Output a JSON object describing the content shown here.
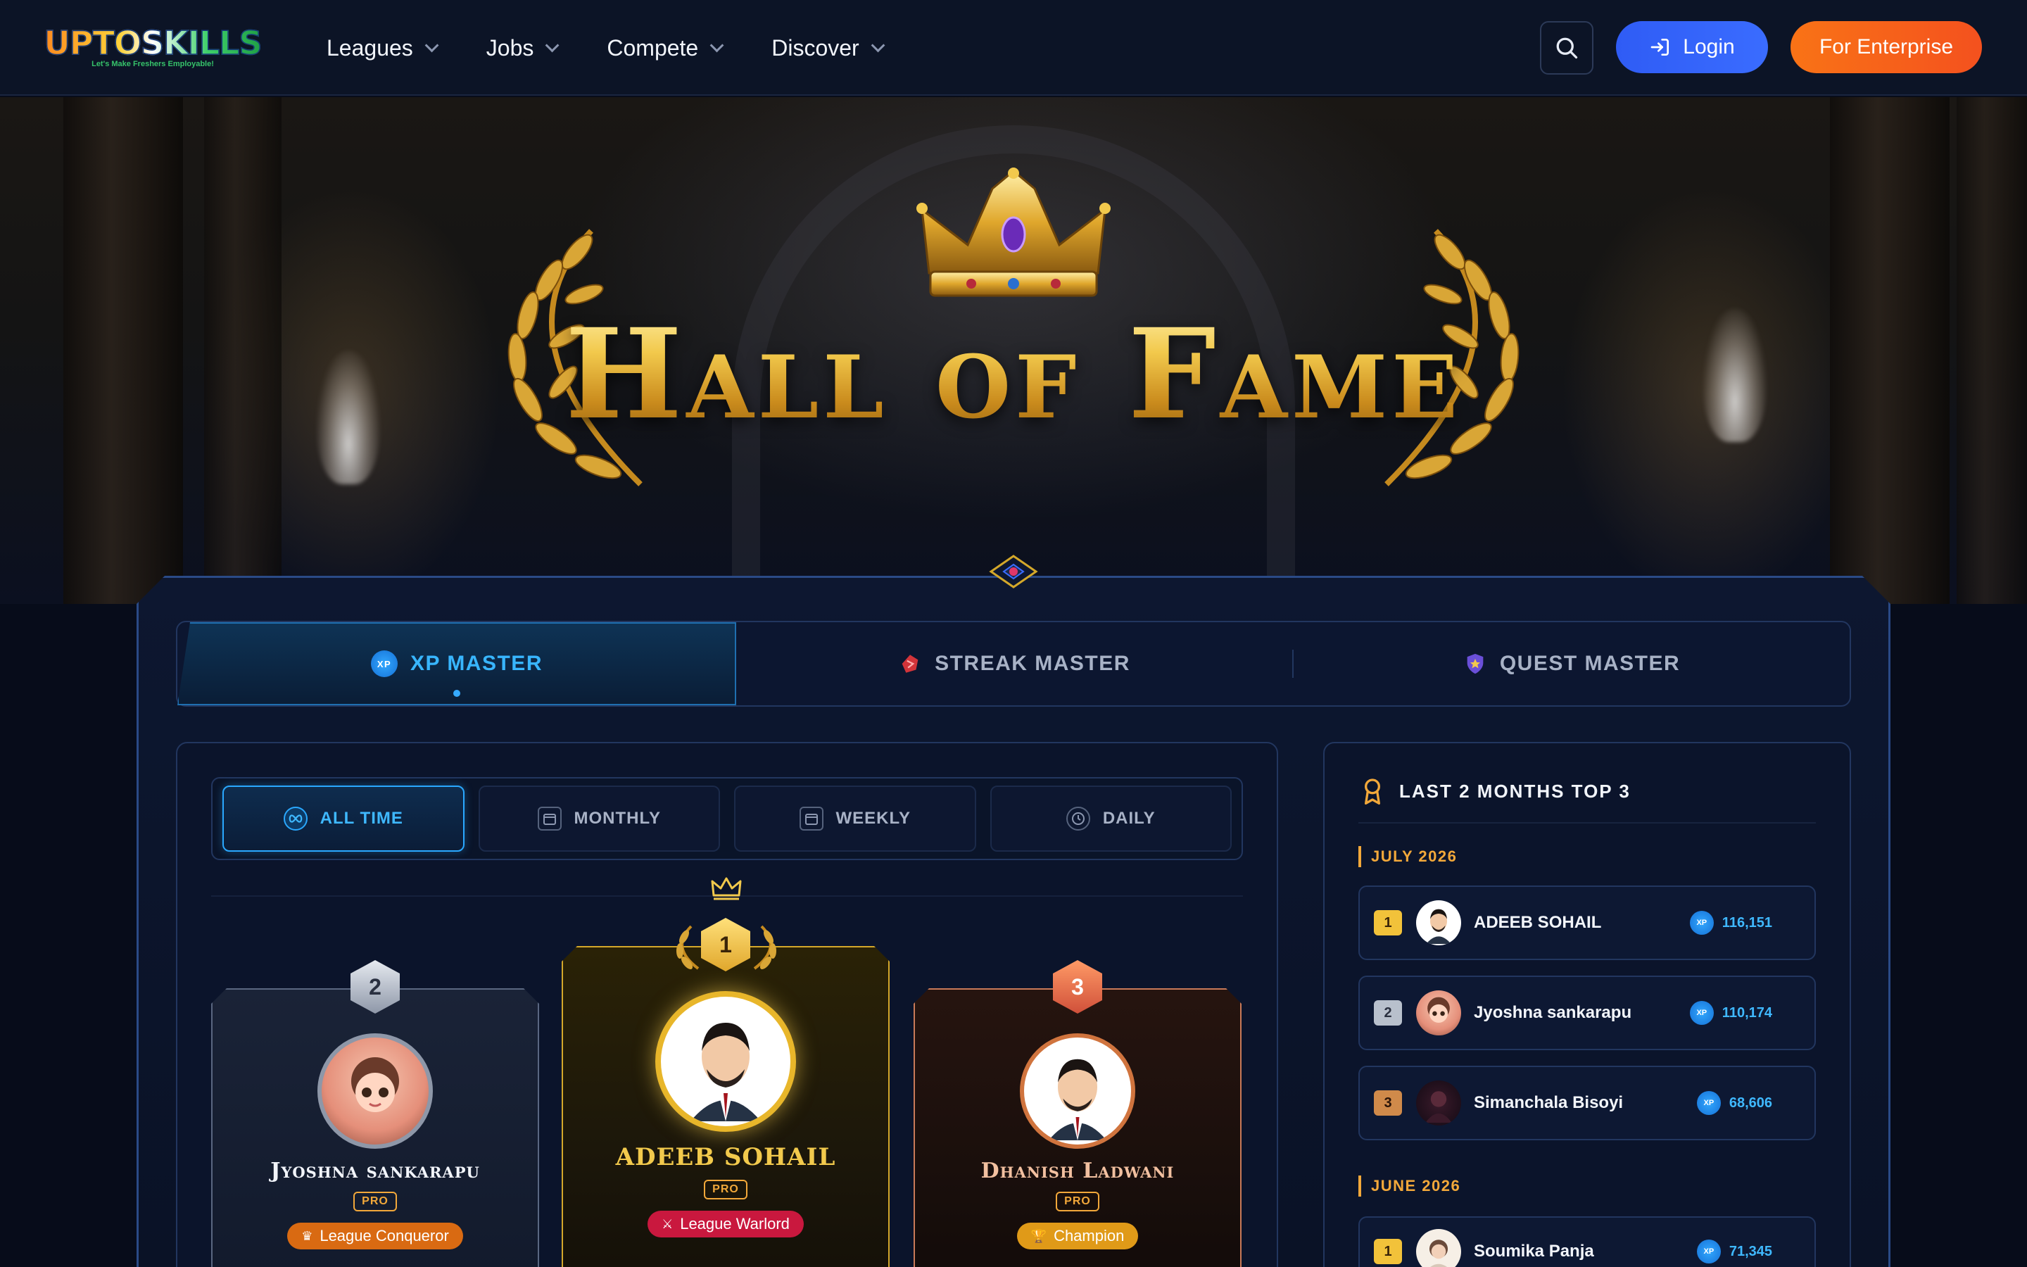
{
  "brand": {
    "logo_text": "UPTOSKILLS",
    "tagline": "Let's Make Freshers Employable!"
  },
  "nav": {
    "items": [
      {
        "label": "Leagues"
      },
      {
        "label": "Jobs"
      },
      {
        "label": "Compete"
      },
      {
        "label": "Discover"
      }
    ],
    "login_label": "Login",
    "enterprise_label": "For Enterprise"
  },
  "hero": {
    "title": "Hall of Fame"
  },
  "category_tabs": [
    {
      "label": "XP MASTER",
      "icon": "xp-icon",
      "active": true
    },
    {
      "label": "STREAK MASTER",
      "icon": "streak-icon",
      "active": false
    },
    {
      "label": "QUEST MASTER",
      "icon": "shield-star-icon",
      "active": false
    }
  ],
  "xp_icon_text": "XP",
  "period_tabs": [
    {
      "label": "ALL TIME",
      "icon": "infinity-icon",
      "active": true
    },
    {
      "label": "MONTHLY",
      "icon": "calendar-icon",
      "active": false
    },
    {
      "label": "WEEKLY",
      "icon": "calendar-icon",
      "active": false
    },
    {
      "label": "DAILY",
      "icon": "clock-icon",
      "active": false
    }
  ],
  "podium": {
    "first": {
      "rank": "1",
      "name": "ADEEB SOHAIL",
      "badge": "PRO",
      "title": "League Warlord"
    },
    "second": {
      "rank": "2",
      "name": "Jyoshna sankarapu",
      "badge": "PRO",
      "title": "League Conqueror"
    },
    "third": {
      "rank": "3",
      "name": "Dhanish Ladwani",
      "badge": "PRO",
      "title": "Champion"
    }
  },
  "top3": {
    "title": "LAST 2 MONTHS TOP 3",
    "months": [
      {
        "label": "JULY 2026",
        "entries": [
          {
            "rank": "1",
            "name": "ADEEB SOHAIL",
            "xp": "116,151"
          },
          {
            "rank": "2",
            "name": "Jyoshna sankarapu",
            "xp": "110,174"
          },
          {
            "rank": "3",
            "name": "Simanchala Bisoyi",
            "xp": "68,606"
          }
        ]
      },
      {
        "label": "JUNE 2026",
        "entries": [
          {
            "rank": "1",
            "name": "Soumika Panja",
            "xp": "71,345"
          }
        ]
      }
    ]
  },
  "colors": {
    "accent_blue": "#38b6ff",
    "gold": "#f2c94c",
    "silver": "#b8c0cc",
    "bronze": "#e07a4a",
    "enterprise": "#f4511e",
    "login": "#3a6cff"
  }
}
